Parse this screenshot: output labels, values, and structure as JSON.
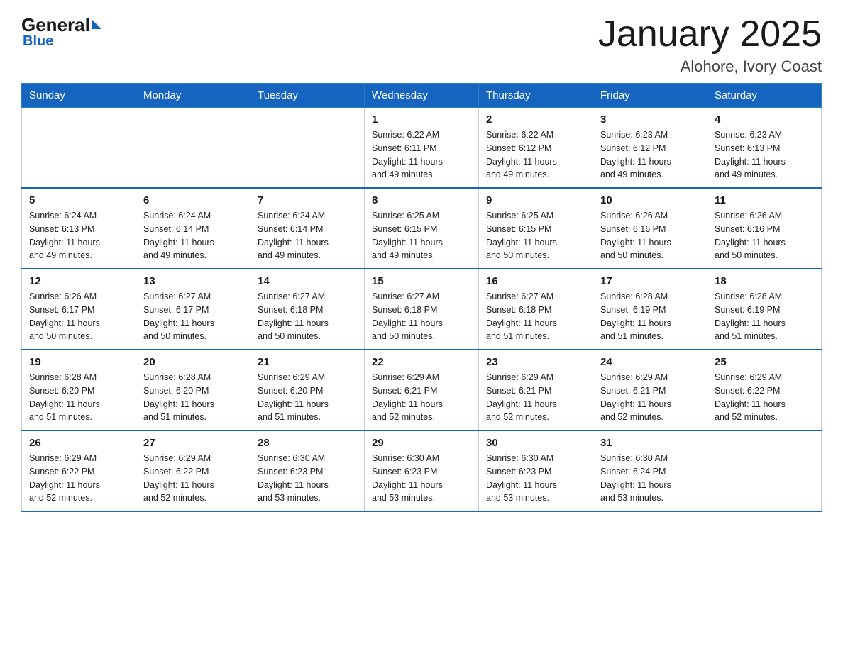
{
  "logo": {
    "general": "General",
    "blue": "Blue"
  },
  "title": "January 2025",
  "subtitle": "Alohore, Ivory Coast",
  "weekdays": [
    "Sunday",
    "Monday",
    "Tuesday",
    "Wednesday",
    "Thursday",
    "Friday",
    "Saturday"
  ],
  "weeks": [
    [
      {
        "day": "",
        "info": ""
      },
      {
        "day": "",
        "info": ""
      },
      {
        "day": "",
        "info": ""
      },
      {
        "day": "1",
        "info": "Sunrise: 6:22 AM\nSunset: 6:11 PM\nDaylight: 11 hours\nand 49 minutes."
      },
      {
        "day": "2",
        "info": "Sunrise: 6:22 AM\nSunset: 6:12 PM\nDaylight: 11 hours\nand 49 minutes."
      },
      {
        "day": "3",
        "info": "Sunrise: 6:23 AM\nSunset: 6:12 PM\nDaylight: 11 hours\nand 49 minutes."
      },
      {
        "day": "4",
        "info": "Sunrise: 6:23 AM\nSunset: 6:13 PM\nDaylight: 11 hours\nand 49 minutes."
      }
    ],
    [
      {
        "day": "5",
        "info": "Sunrise: 6:24 AM\nSunset: 6:13 PM\nDaylight: 11 hours\nand 49 minutes."
      },
      {
        "day": "6",
        "info": "Sunrise: 6:24 AM\nSunset: 6:14 PM\nDaylight: 11 hours\nand 49 minutes."
      },
      {
        "day": "7",
        "info": "Sunrise: 6:24 AM\nSunset: 6:14 PM\nDaylight: 11 hours\nand 49 minutes."
      },
      {
        "day": "8",
        "info": "Sunrise: 6:25 AM\nSunset: 6:15 PM\nDaylight: 11 hours\nand 49 minutes."
      },
      {
        "day": "9",
        "info": "Sunrise: 6:25 AM\nSunset: 6:15 PM\nDaylight: 11 hours\nand 50 minutes."
      },
      {
        "day": "10",
        "info": "Sunrise: 6:26 AM\nSunset: 6:16 PM\nDaylight: 11 hours\nand 50 minutes."
      },
      {
        "day": "11",
        "info": "Sunrise: 6:26 AM\nSunset: 6:16 PM\nDaylight: 11 hours\nand 50 minutes."
      }
    ],
    [
      {
        "day": "12",
        "info": "Sunrise: 6:26 AM\nSunset: 6:17 PM\nDaylight: 11 hours\nand 50 minutes."
      },
      {
        "day": "13",
        "info": "Sunrise: 6:27 AM\nSunset: 6:17 PM\nDaylight: 11 hours\nand 50 minutes."
      },
      {
        "day": "14",
        "info": "Sunrise: 6:27 AM\nSunset: 6:18 PM\nDaylight: 11 hours\nand 50 minutes."
      },
      {
        "day": "15",
        "info": "Sunrise: 6:27 AM\nSunset: 6:18 PM\nDaylight: 11 hours\nand 50 minutes."
      },
      {
        "day": "16",
        "info": "Sunrise: 6:27 AM\nSunset: 6:18 PM\nDaylight: 11 hours\nand 51 minutes."
      },
      {
        "day": "17",
        "info": "Sunrise: 6:28 AM\nSunset: 6:19 PM\nDaylight: 11 hours\nand 51 minutes."
      },
      {
        "day": "18",
        "info": "Sunrise: 6:28 AM\nSunset: 6:19 PM\nDaylight: 11 hours\nand 51 minutes."
      }
    ],
    [
      {
        "day": "19",
        "info": "Sunrise: 6:28 AM\nSunset: 6:20 PM\nDaylight: 11 hours\nand 51 minutes."
      },
      {
        "day": "20",
        "info": "Sunrise: 6:28 AM\nSunset: 6:20 PM\nDaylight: 11 hours\nand 51 minutes."
      },
      {
        "day": "21",
        "info": "Sunrise: 6:29 AM\nSunset: 6:20 PM\nDaylight: 11 hours\nand 51 minutes."
      },
      {
        "day": "22",
        "info": "Sunrise: 6:29 AM\nSunset: 6:21 PM\nDaylight: 11 hours\nand 52 minutes."
      },
      {
        "day": "23",
        "info": "Sunrise: 6:29 AM\nSunset: 6:21 PM\nDaylight: 11 hours\nand 52 minutes."
      },
      {
        "day": "24",
        "info": "Sunrise: 6:29 AM\nSunset: 6:21 PM\nDaylight: 11 hours\nand 52 minutes."
      },
      {
        "day": "25",
        "info": "Sunrise: 6:29 AM\nSunset: 6:22 PM\nDaylight: 11 hours\nand 52 minutes."
      }
    ],
    [
      {
        "day": "26",
        "info": "Sunrise: 6:29 AM\nSunset: 6:22 PM\nDaylight: 11 hours\nand 52 minutes."
      },
      {
        "day": "27",
        "info": "Sunrise: 6:29 AM\nSunset: 6:22 PM\nDaylight: 11 hours\nand 52 minutes."
      },
      {
        "day": "28",
        "info": "Sunrise: 6:30 AM\nSunset: 6:23 PM\nDaylight: 11 hours\nand 53 minutes."
      },
      {
        "day": "29",
        "info": "Sunrise: 6:30 AM\nSunset: 6:23 PM\nDaylight: 11 hours\nand 53 minutes."
      },
      {
        "day": "30",
        "info": "Sunrise: 6:30 AM\nSunset: 6:23 PM\nDaylight: 11 hours\nand 53 minutes."
      },
      {
        "day": "31",
        "info": "Sunrise: 6:30 AM\nSunset: 6:24 PM\nDaylight: 11 hours\nand 53 minutes."
      },
      {
        "day": "",
        "info": ""
      }
    ]
  ]
}
